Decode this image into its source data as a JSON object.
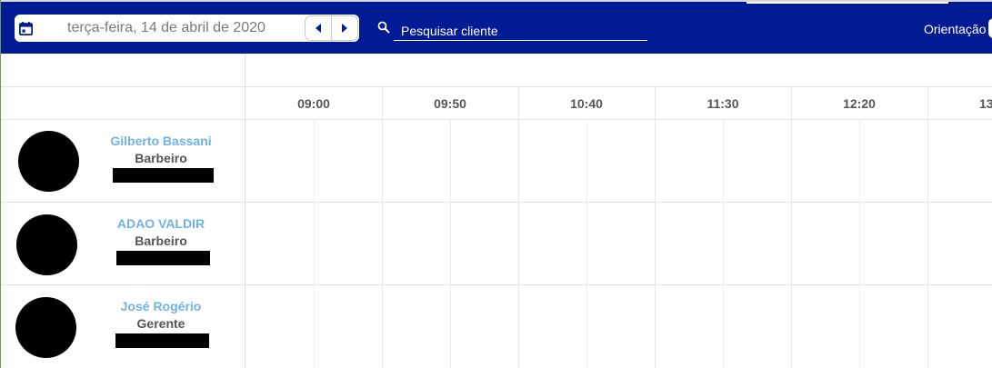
{
  "header": {
    "date": "terça-feira, 14 de abril de 2020",
    "search": {
      "placeholder": "Pesquisar cliente",
      "value": ""
    },
    "orientation_label": "Orientação",
    "icons": {
      "calendar": "calendar-icon",
      "prev": "caret-left-icon",
      "next": "caret-right-icon",
      "search": "search-icon"
    }
  },
  "schedule": {
    "time_slots": [
      "09:00",
      "09:50",
      "10:40",
      "11:30",
      "12:20",
      "13"
    ],
    "employees": [
      {
        "name": "Gilberto Bassani",
        "role": "Barbeiro"
      },
      {
        "name": "ADAO VALDIR",
        "role": "Barbeiro"
      },
      {
        "name": "José Rogério",
        "role": "Gerente"
      }
    ]
  },
  "colors": {
    "header_bg": "#001b94",
    "name_color": "#6fb1ea",
    "role_color": "#555555"
  }
}
